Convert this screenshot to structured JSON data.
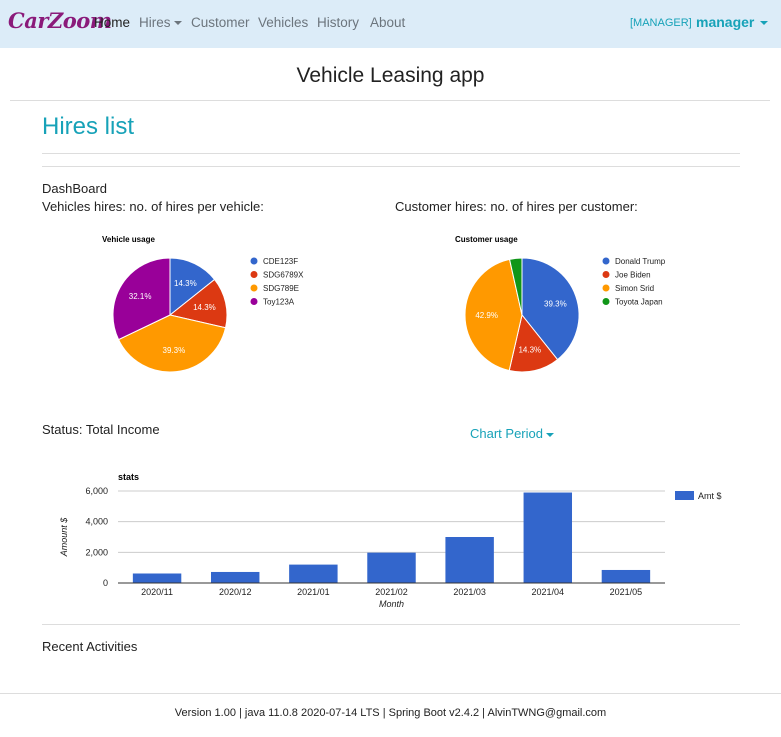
{
  "navbar": {
    "brand": "CarZoom",
    "items": [
      {
        "label": "Home"
      },
      {
        "label": "Hires"
      },
      {
        "label": "Customer"
      },
      {
        "label": "Vehicles"
      },
      {
        "label": "History"
      },
      {
        "label": "About"
      }
    ],
    "role": "[MANAGER]",
    "user": "manager"
  },
  "page": {
    "app_title": "Vehicle Leasing app",
    "title": "Hires list",
    "dashboard_label": "DashBoard",
    "vehicle_section": "Vehicles hires: no. of hires per vehicle:",
    "customer_section": "Customer hires: no. of hires per customer:",
    "status_label": "Status: Total Income",
    "period_button": "Chart Period",
    "recent_label": "Recent Activities"
  },
  "footer": {
    "text": "Version 1.00 | java 11.0.8 2020-07-14 LTS | Spring Boot v2.4.2 | AlvinTWNG@gmail.com"
  },
  "chart_data": [
    {
      "type": "pie",
      "title": "Vehicle usage",
      "labels": [
        "CDE123F",
        "SDG6789X",
        "SDG789E",
        "Toy123A"
      ],
      "values": [
        14.3,
        14.3,
        39.3,
        32.1
      ],
      "value_labels": [
        "14.3%",
        "14.3%",
        "39.3%",
        "32.1%"
      ],
      "colors": [
        "#3366cc",
        "#dc3912",
        "#ff9900",
        "#990099"
      ],
      "legend": "right"
    },
    {
      "type": "pie",
      "title": "Customer usage",
      "labels": [
        "Donald Trump",
        "Joe Biden",
        "Simon Srid",
        "Toyota Japan"
      ],
      "values": [
        39.3,
        14.3,
        42.9,
        3.5
      ],
      "value_labels": [
        "39.3%",
        "14.3%",
        "42.9%",
        ""
      ],
      "colors": [
        "#3366cc",
        "#dc3912",
        "#ff9900",
        "#109618"
      ],
      "legend": "right"
    },
    {
      "type": "bar",
      "title": "stats",
      "categories": [
        "2020/11",
        "2020/12",
        "2021/01",
        "2021/02",
        "2021/03",
        "2021/04",
        "2021/05"
      ],
      "series": [
        {
          "name": "Amt $",
          "values": [
            620,
            720,
            1200,
            1980,
            3000,
            5900,
            850
          ],
          "color": "#3366cc"
        }
      ],
      "xlabel": "Month",
      "ylabel": "Amount $",
      "ylim": [
        0,
        6000
      ],
      "yticks": [
        "0",
        "2,000",
        "4,000",
        "6,000"
      ],
      "ytick_values": [
        0,
        2000,
        4000,
        6000
      ],
      "grid": true,
      "legend": "right"
    }
  ]
}
